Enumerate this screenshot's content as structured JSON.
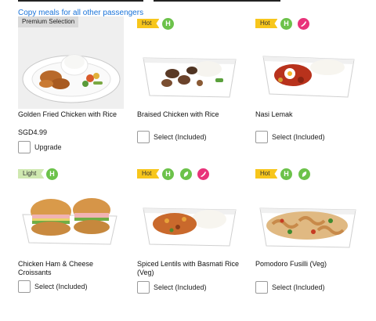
{
  "header": {
    "copy_link": "Copy meals for all other passengers"
  },
  "meals": [
    {
      "ribbon": "Premium Selection",
      "tag": "",
      "badges": [],
      "title": "Golden Fried Chicken with Rice",
      "price": "SGD4.99",
      "option": "Upgrade",
      "image_icon": "fried-chicken-rice-plate"
    },
    {
      "ribbon": "",
      "tag": "Hot",
      "badges": [
        "H"
      ],
      "title": "Braised Chicken with Rice",
      "price": "",
      "option": "Select (Included)",
      "image_icon": "braised-chicken-rice-box"
    },
    {
      "ribbon": "",
      "tag": "Hot",
      "badges": [
        "H",
        "chili"
      ],
      "title": "Nasi Lemak",
      "price": "",
      "option": "Select (Included)",
      "image_icon": "nasi-lemak-box"
    },
    {
      "ribbon": "",
      "tag": "Light",
      "badges": [
        "H"
      ],
      "title": "Chicken Ham & Cheese Croissants",
      "price": "",
      "option": "Select (Included)",
      "image_icon": "croissant-sandwich-tray"
    },
    {
      "ribbon": "",
      "tag": "Hot",
      "badges": [
        "H",
        "leaf",
        "chili"
      ],
      "title": "Spiced Lentils with Basmati Rice (Veg)",
      "price": "",
      "option": "Select (Included)",
      "image_icon": "lentils-rice-box"
    },
    {
      "ribbon": "",
      "tag": "Hot",
      "badges": [
        "H",
        "leaf"
      ],
      "title": "Pomodoro Fusilli (Veg)",
      "price": "",
      "option": "Select (Included)",
      "image_icon": "fusilli-pasta-box"
    }
  ],
  "colors": {
    "link": "#1a73d9",
    "hot": "#f7c61c",
    "light": "#cfe8b0",
    "halal": "#6cc24a",
    "spicy": "#e8337a"
  }
}
